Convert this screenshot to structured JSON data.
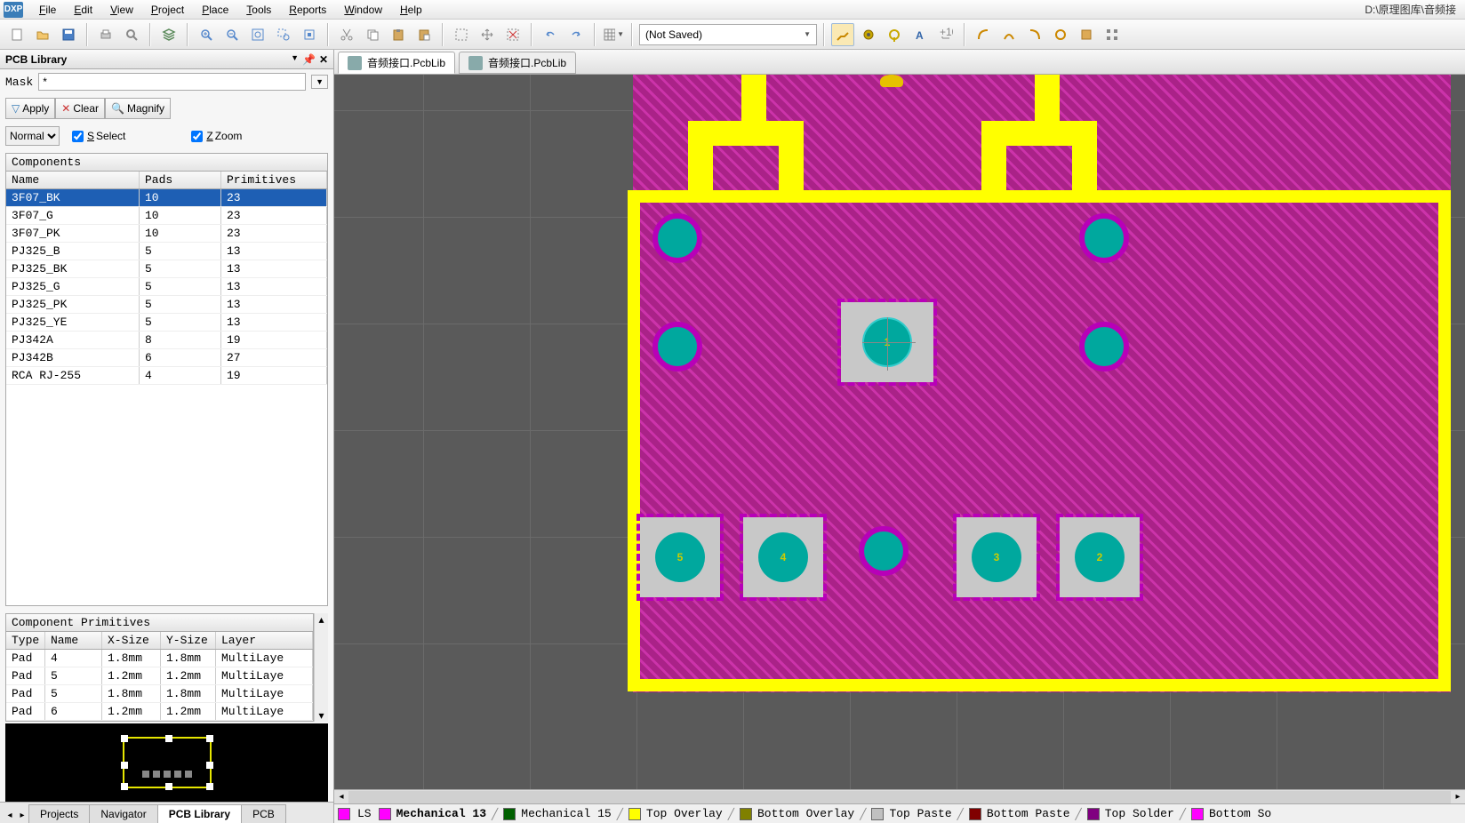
{
  "menubar": {
    "logo": "DXP",
    "items": [
      "File",
      "Edit",
      "View",
      "Project",
      "Place",
      "Tools",
      "Reports",
      "Window",
      "Help"
    ],
    "path": "D:\\原理图库\\音频接"
  },
  "toolbar": {
    "save_combo": "(Not Saved)"
  },
  "panel": {
    "title": "PCB Library",
    "mask_label": "Mask",
    "mask_value": "*",
    "apply": "Apply",
    "clear": "Clear",
    "magnify": "Magnify",
    "mode": "Normal",
    "select_label": "Select",
    "zoom_label": "Zoom"
  },
  "components": {
    "title": "Components",
    "headers": [
      "Name",
      "Pads",
      "Primitives"
    ],
    "rows": [
      {
        "name": "3F07_BK",
        "pads": "10",
        "prims": "23",
        "selected": true
      },
      {
        "name": "3F07_G",
        "pads": "10",
        "prims": "23"
      },
      {
        "name": "3F07_PK",
        "pads": "10",
        "prims": "23"
      },
      {
        "name": "PJ325_B",
        "pads": "5",
        "prims": "13"
      },
      {
        "name": "PJ325_BK",
        "pads": "5",
        "prims": "13"
      },
      {
        "name": "PJ325_G",
        "pads": "5",
        "prims": "13"
      },
      {
        "name": "PJ325_PK",
        "pads": "5",
        "prims": "13"
      },
      {
        "name": "PJ325_YE",
        "pads": "5",
        "prims": "13"
      },
      {
        "name": "PJ342A",
        "pads": "8",
        "prims": "19"
      },
      {
        "name": "PJ342B",
        "pads": "6",
        "prims": "27"
      },
      {
        "name": "RCA RJ-255",
        "pads": "4",
        "prims": "19"
      }
    ]
  },
  "primitives": {
    "title": "Component Primitives",
    "headers": [
      "Type",
      "Name",
      "X-Size",
      "Y-Size",
      "Layer"
    ],
    "rows": [
      {
        "type": "Pad",
        "name": "4",
        "x": "1.8mm",
        "y": "1.8mm",
        "layer": "MultiLaye"
      },
      {
        "type": "Pad",
        "name": "5",
        "x": "1.2mm",
        "y": "1.2mm",
        "layer": "MultiLaye"
      },
      {
        "type": "Pad",
        "name": "5",
        "x": "1.8mm",
        "y": "1.8mm",
        "layer": "MultiLaye"
      },
      {
        "type": "Pad",
        "name": "6",
        "x": "1.2mm",
        "y": "1.2mm",
        "layer": "MultiLaye"
      }
    ]
  },
  "bottom_tabs_left": [
    "Projects",
    "Navigator",
    "PCB Library",
    "PCB"
  ],
  "doc_tabs": [
    {
      "label": "音频接口.PcbLib",
      "active": true
    },
    {
      "label": "音频接口.PcbLib",
      "active": false
    }
  ],
  "pad_numbers": {
    "p1": "1",
    "p2": "2",
    "p3": "3",
    "p4": "4",
    "p5": "5"
  },
  "layer_tabs": {
    "ls": "LS",
    "items": [
      {
        "color": "#ff00ff",
        "label": "Mechanical 13",
        "current": true
      },
      {
        "color": "#006000",
        "label": "Mechanical 15"
      },
      {
        "color": "#ffff00",
        "label": "Top Overlay"
      },
      {
        "color": "#808000",
        "label": "Bottom Overlay"
      },
      {
        "color": "#c0c0c0",
        "label": "Top Paste"
      },
      {
        "color": "#800000",
        "label": "Bottom Paste"
      },
      {
        "color": "#800080",
        "label": "Top Solder"
      },
      {
        "color": "#ff00ff",
        "label": "Bottom So"
      }
    ]
  }
}
